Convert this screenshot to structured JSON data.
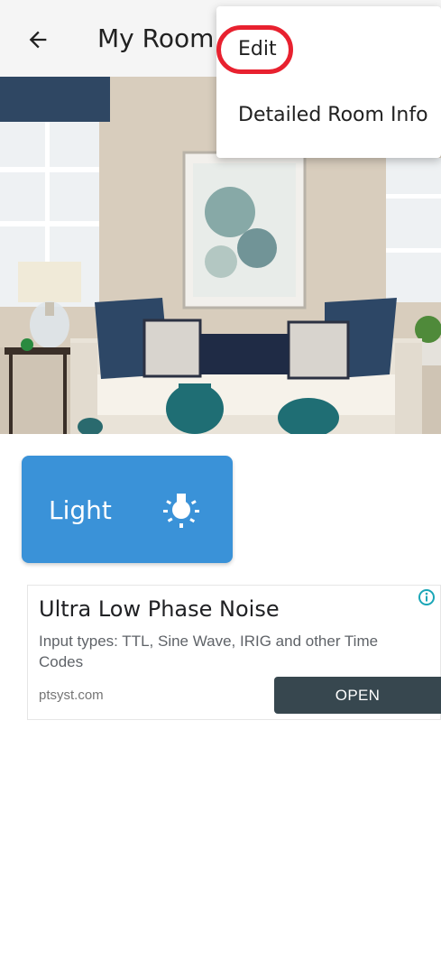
{
  "app_bar": {
    "back_icon": "arrow-back-icon",
    "title": "My Room"
  },
  "hero_image": {
    "description_icon": "room-photo"
  },
  "light_card": {
    "label": "Light",
    "icon": "lightbulb-icon"
  },
  "ad": {
    "title": "Ultra Low Phase Noise",
    "description": "Input types: TTL, Sine Wave, IRIG and other Time Codes",
    "domain": "ptsyst.com",
    "button_label": "OPEN",
    "info_icon": "info-icon"
  },
  "menu": {
    "items": [
      {
        "label": "Edit"
      },
      {
        "label": "Detailed Room Info"
      }
    ]
  },
  "colors": {
    "light_card": "#3a92d8",
    "open_button": "#37474f",
    "highlight": "#e8212f"
  }
}
